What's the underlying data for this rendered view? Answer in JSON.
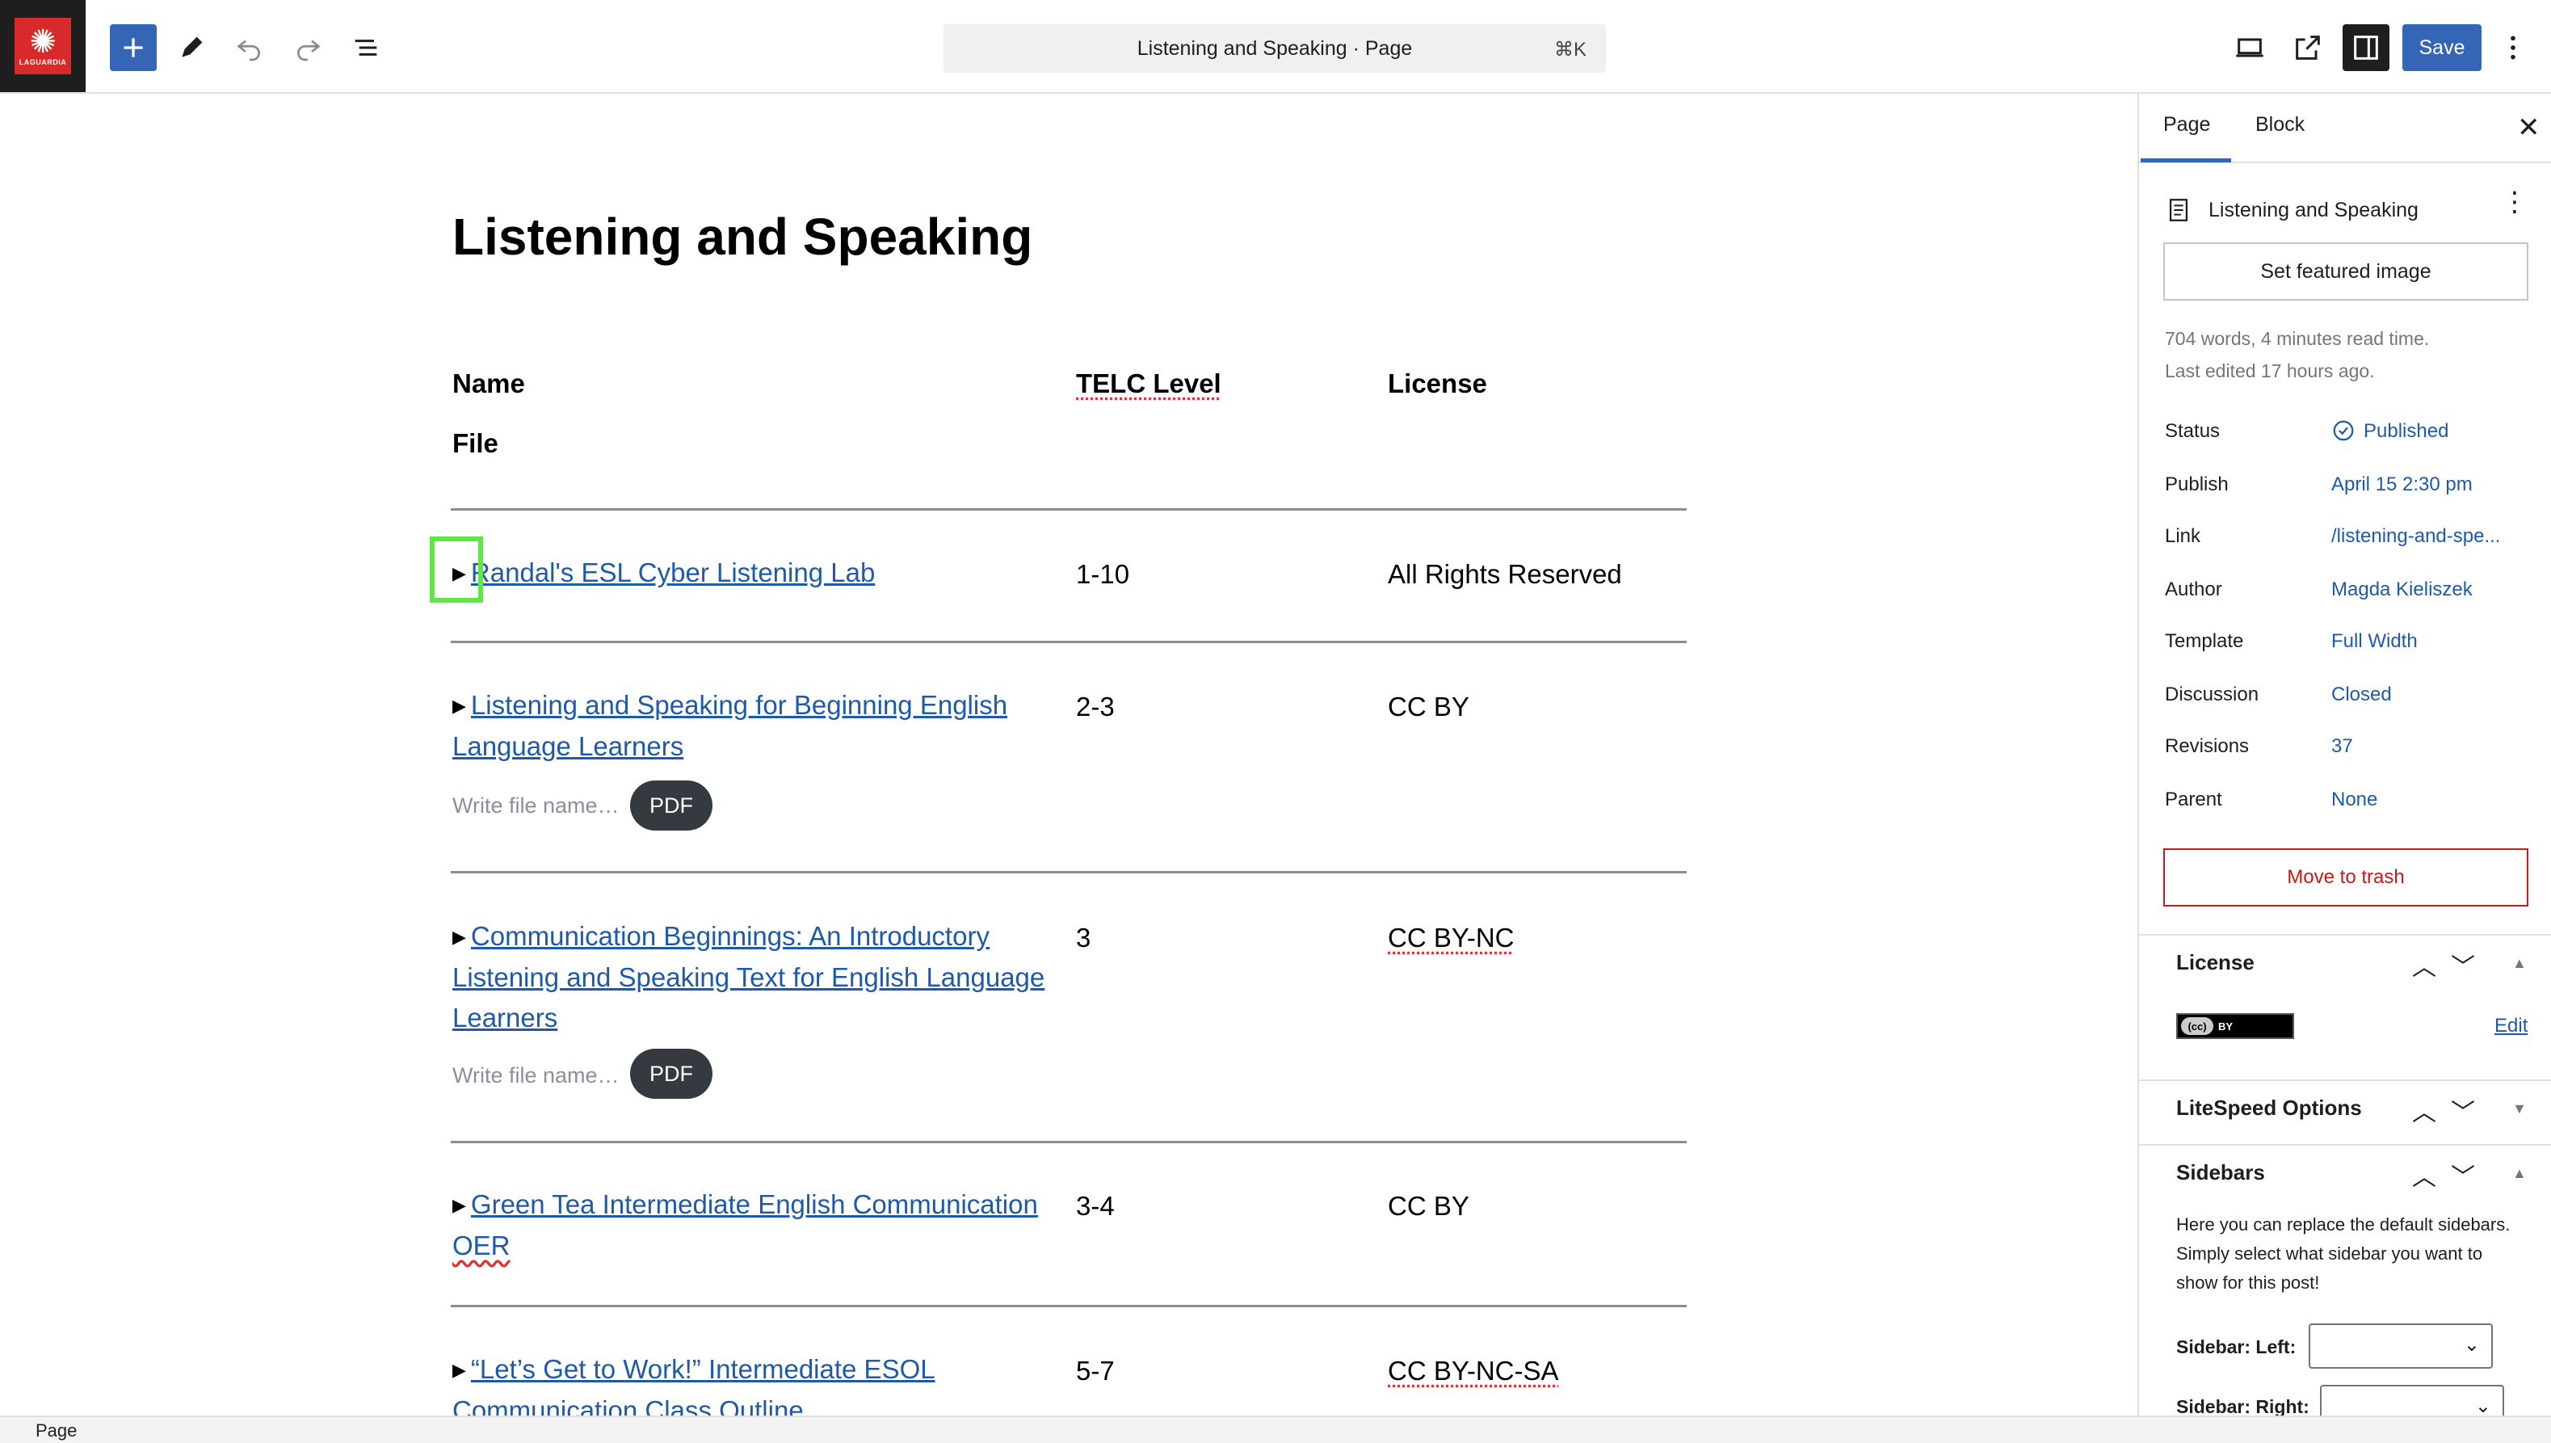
{
  "logo": {
    "mark": "✺",
    "text": "LAGUARDIA"
  },
  "toolbar": {
    "command_title": "Listening and Speaking · Page",
    "command_shortcut": "⌘K",
    "save_label": "Save"
  },
  "content": {
    "title": "Listening and Speaking",
    "headers": {
      "name": "Name",
      "level": "TELC Level",
      "license": "License",
      "file": "File"
    },
    "file_placeholder": "Write file name…",
    "pdf_label": "PDF",
    "rows": [
      {
        "name_line1": "Randal's ESL Cyber Listening Lab",
        "level": "1-10",
        "license": "All Rights Reserved"
      },
      {
        "name_line1": "Listening and Speaking for Beginning English",
        "name_line2": "Language Learners",
        "level": "2-3",
        "license": "CC BY"
      },
      {
        "name_line1": "Communication Beginnings: An Introductory",
        "name_line2": "Listening and Speaking Text for English Language",
        "name_line3": "Learners",
        "level": "3",
        "license": "CC BY-NC"
      },
      {
        "name_line1": "Green Tea Intermediate English Communication",
        "name_line2": "OER",
        "level": "3-4",
        "license": "CC BY"
      },
      {
        "name_line1": "“Let’s Get to Work!” Intermediate ESOL",
        "name_line2": "Communication Class Outline",
        "level": "5-7",
        "license": "CC BY-NC-SA"
      }
    ]
  },
  "sidebar": {
    "tabs": {
      "page": "Page",
      "block": "Block"
    },
    "doc_title": "Listening and Speaking",
    "featured_image": "Set featured image",
    "stats": "704 words, 4 minutes read time.",
    "last_edited": "Last edited 17 hours ago.",
    "fields": {
      "status": {
        "label": "Status",
        "value": "Published"
      },
      "publish": {
        "label": "Publish",
        "value": "April 15 2:30 pm"
      },
      "link": {
        "label": "Link",
        "value": "/listening-and-spe..."
      },
      "author": {
        "label": "Author",
        "value": "Magda Kieliszek"
      },
      "template": {
        "label": "Template",
        "value": "Full Width"
      },
      "discussion": {
        "label": "Discussion",
        "value": "Closed"
      },
      "revisions": {
        "label": "Revisions",
        "value": "37"
      },
      "parent": {
        "label": "Parent",
        "value": "None"
      }
    },
    "trash": "Move to trash",
    "license_panel": {
      "title": "License",
      "badge_cc": "(cc)",
      "badge_by": "BY",
      "edit": "Edit"
    },
    "litespeed_panel": {
      "title": "LiteSpeed Options"
    },
    "sidebars_panel": {
      "title": "Sidebars",
      "help": "Here you can replace the default sidebars. Simply select what sidebar you want to show for this post!",
      "left_label": "Sidebar: Left:",
      "right_label": "Sidebar: Right:"
    }
  },
  "footer": {
    "breadcrumb": "Page"
  },
  "colors": {
    "accent": "#3565b5",
    "link": "#1e5aa8",
    "danger": "#cc1818",
    "focus": "#5ee843"
  }
}
